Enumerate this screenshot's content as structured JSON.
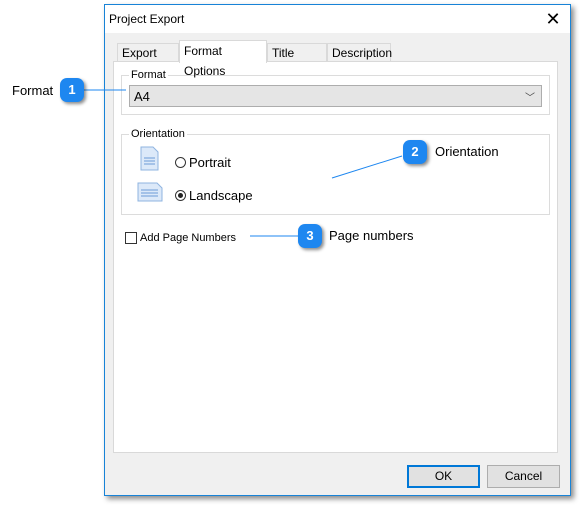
{
  "window": {
    "title": "Project Export",
    "close_icon": "close-icon"
  },
  "tabs": [
    {
      "label": "Export Data",
      "active": false
    },
    {
      "label": "Format Options",
      "active": true
    },
    {
      "label": "Title Page",
      "active": false
    },
    {
      "label": "Description",
      "active": false
    }
  ],
  "format_group": {
    "legend": "Format",
    "selected_value": "A4",
    "dropdown_icon": "chevron-down-icon"
  },
  "orientation_group": {
    "legend": "Orientation",
    "options": [
      {
        "label": "Portrait",
        "selected": false,
        "icon": "portrait-page-icon"
      },
      {
        "label": "Landscape",
        "selected": true,
        "icon": "landscape-page-icon"
      }
    ]
  },
  "page_numbers": {
    "label": "Add Page Numbers",
    "checked": false
  },
  "buttons": {
    "ok": "OK",
    "cancel": "Cancel"
  },
  "callouts": [
    {
      "number": "1",
      "label": "Format"
    },
    {
      "number": "2",
      "label": "Orientation"
    },
    {
      "number": "3",
      "label": "Page numbers"
    }
  ],
  "colors": {
    "accent": "#1e87f0",
    "window_border": "#1883d7"
  }
}
